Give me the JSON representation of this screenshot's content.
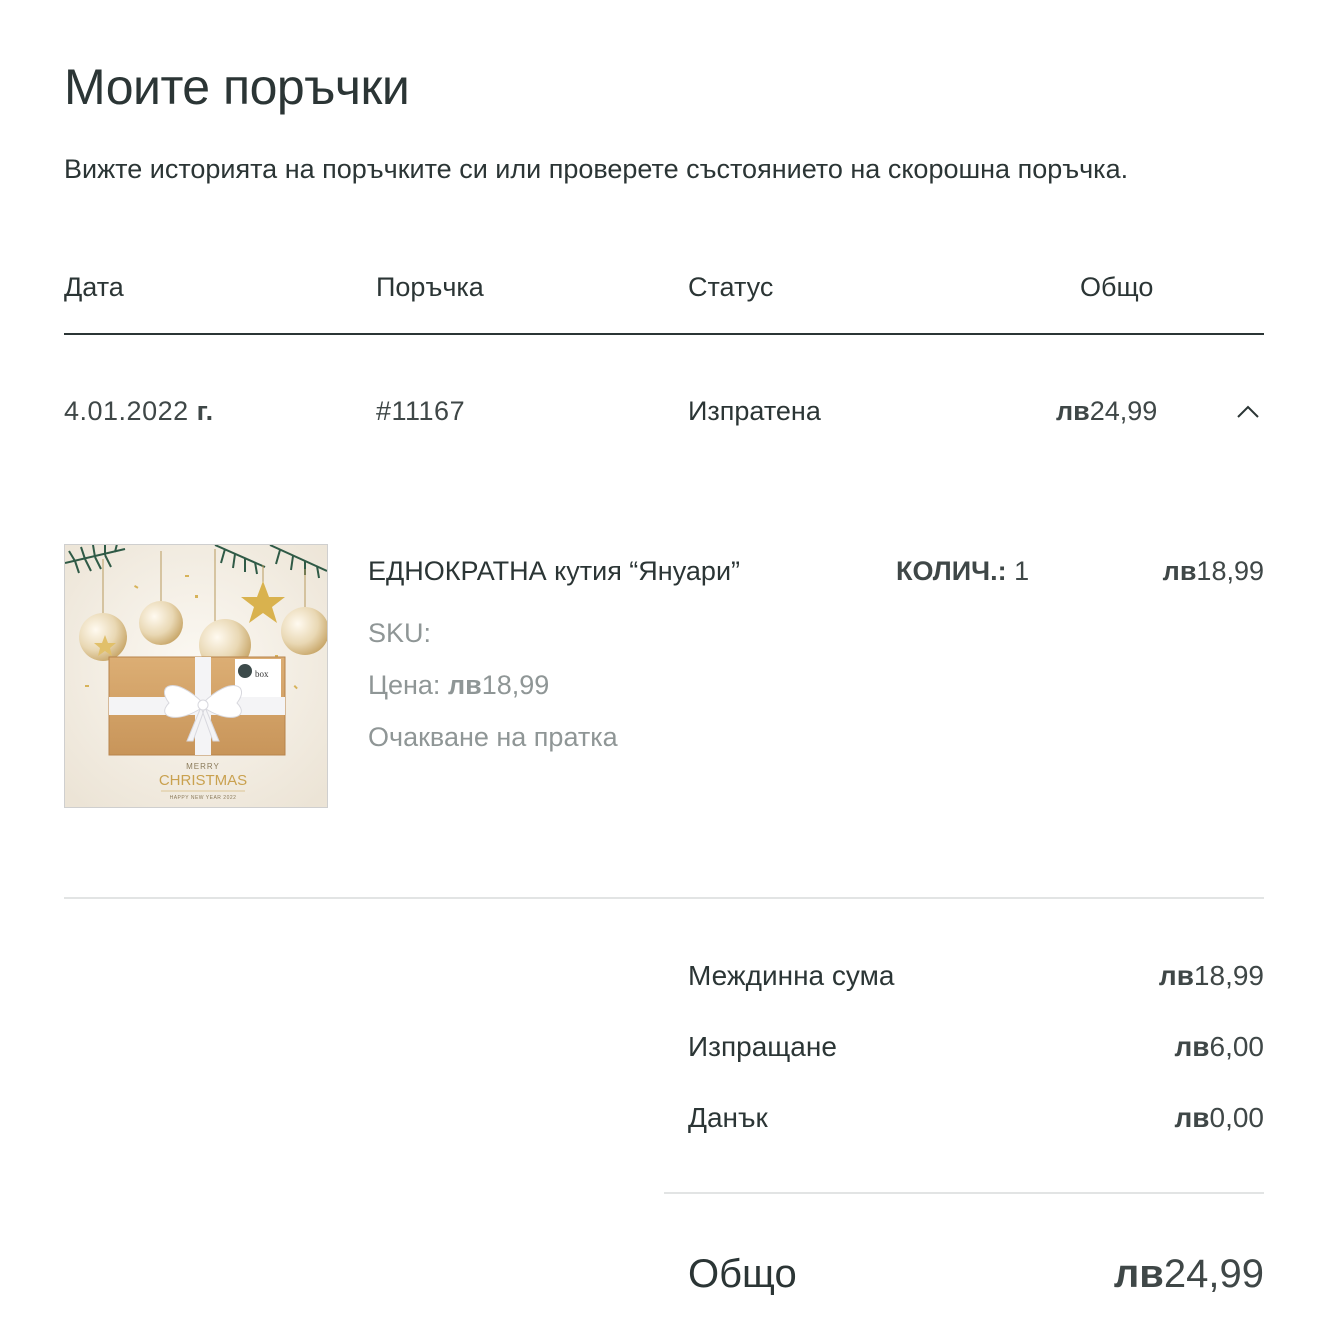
{
  "page": {
    "title": "Моите поръчки",
    "subtitle": "Вижте историята на поръчките си или проверете състоянието на скорошна поръчка."
  },
  "table": {
    "headers": {
      "date": "Дата",
      "order": "Поръчка",
      "status": "Статус",
      "total": "Общо"
    }
  },
  "order": {
    "date": "4.01.2022",
    "date_suffix": "г.",
    "number": "#11167",
    "status": "Изпратена",
    "currency": "лв",
    "total": "24,99",
    "toggle_icon": "chevron-up-icon"
  },
  "item": {
    "title": "ЕДНОКРАТНА кутия “Януари”",
    "qty_label": "КОЛИЧ.:",
    "qty_value": "1",
    "currency": "лв",
    "price": "18,99",
    "sku_label": "SKU:",
    "price_label": "Цена:",
    "price_currency": "лв",
    "price_value": "18,99",
    "fulfillment_status": "Очакване на пратка",
    "image_text": {
      "merry": "MERRY",
      "christmas": "CHRISTMAS",
      "new_year": "HAPPY NEW YEAR 2022",
      "box_label": "box"
    }
  },
  "summary": {
    "subtotal_label": "Междинна сума",
    "subtotal_currency": "лв",
    "subtotal_value": "18,99",
    "shipping_label": "Изпращане",
    "shipping_currency": "лв",
    "shipping_value": "6,00",
    "tax_label": "Данък",
    "tax_currency": "лв",
    "tax_value": "0,00",
    "total_label": "Общо",
    "total_currency": "лв",
    "total_value": "24,99"
  },
  "colors": {
    "text": "#2b3535",
    "muted": "#8f9696",
    "divider": "#e2e4e4"
  }
}
